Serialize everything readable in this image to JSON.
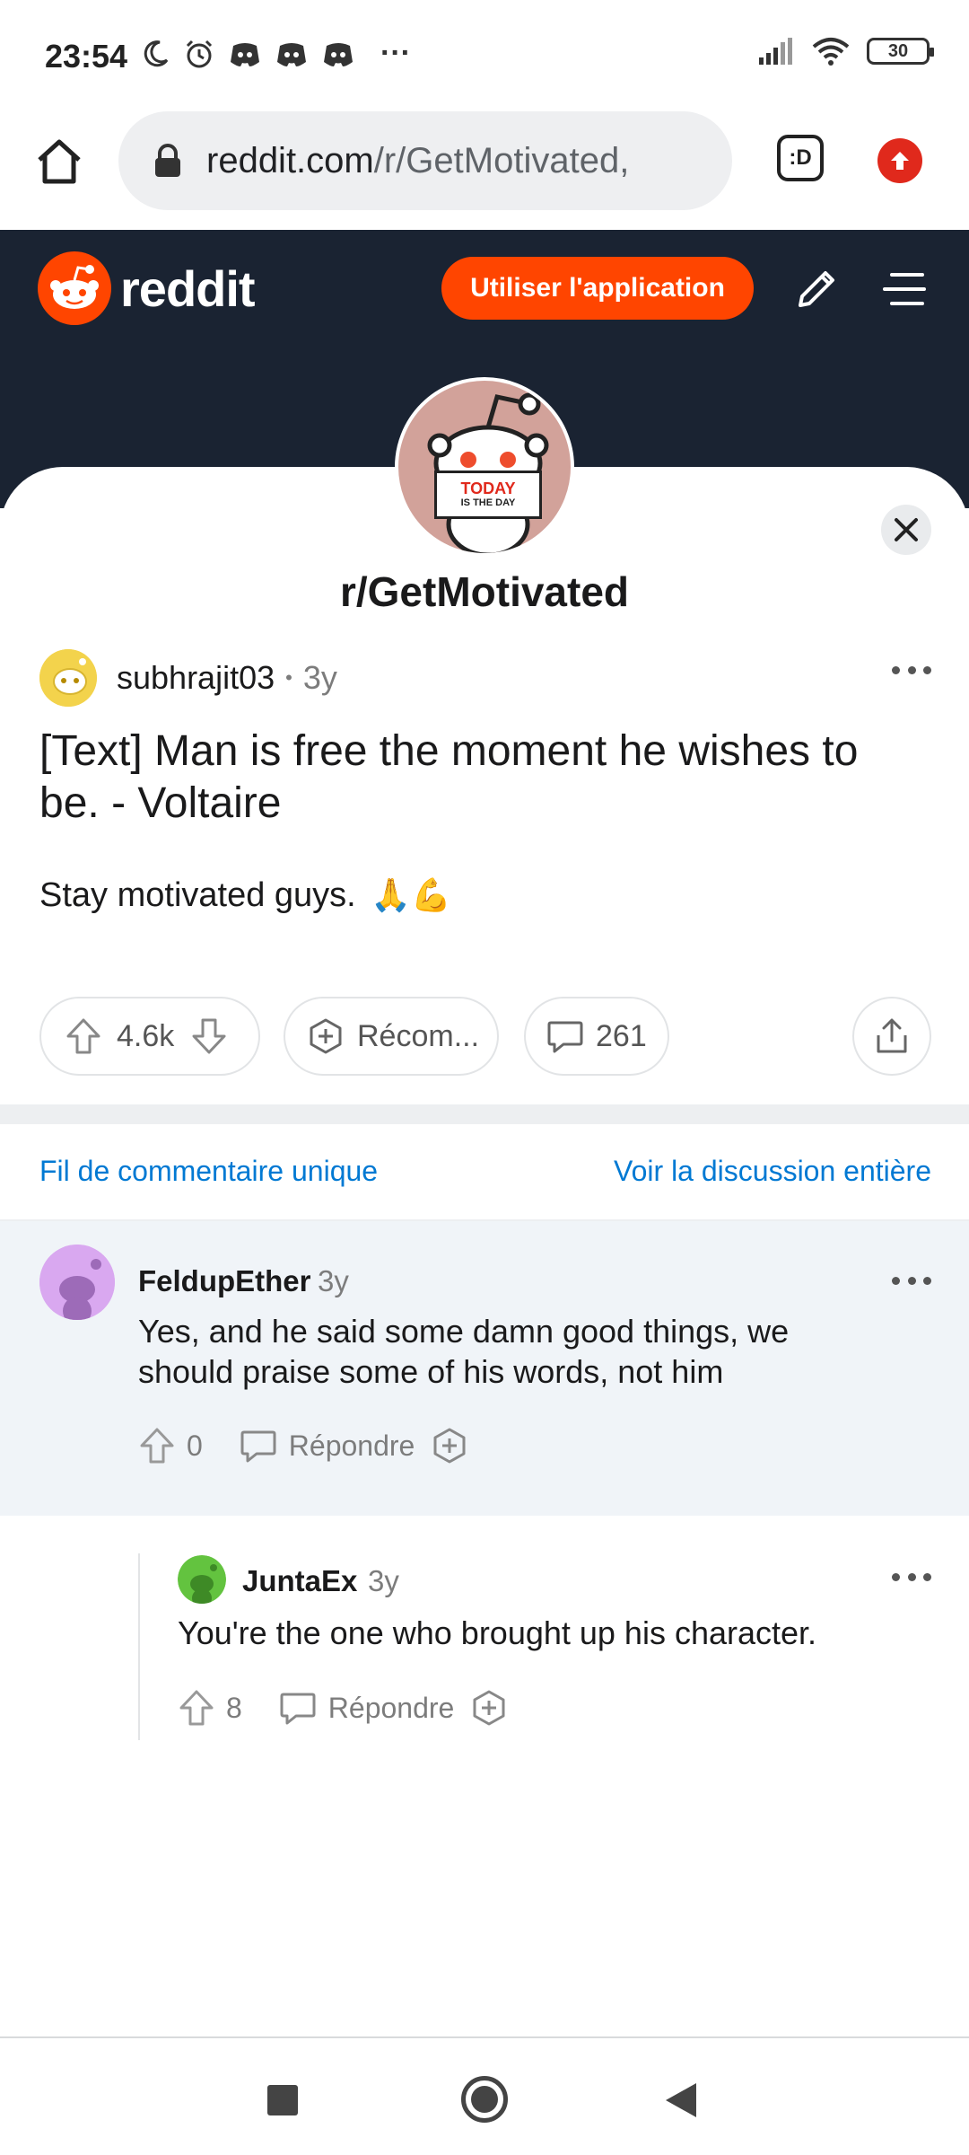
{
  "status_bar": {
    "time": "23:54",
    "battery": "30",
    "more": "···"
  },
  "browser": {
    "url_domain": "reddit.com",
    "url_path": "/r/GetMotivated,",
    "tab_button": ":D"
  },
  "reddit_header": {
    "wordmark": "reddit",
    "app_button": "Utiliser l'application",
    "brand_color": "#ff4500"
  },
  "community": {
    "avatar_line1": "TODAY",
    "avatar_line2": "IS THE DAY",
    "name": "r/GetMotivated"
  },
  "post": {
    "author": "subhrajit03",
    "separator": "•",
    "age": "3y",
    "title": "[Text] Man is free the moment he wishes to be. - Voltaire",
    "body": "Stay motivated guys.",
    "body_emoji": "🙏💪",
    "score": "4.6k",
    "award_label": "Récom...",
    "comments_count": "261"
  },
  "thread_links": {
    "single_thread": "Fil de commentaire unique",
    "full_discussion": "Voir la discussion entière",
    "link_color": "#0079d3"
  },
  "comments": [
    {
      "author": "FeldupEther",
      "age": "3y",
      "text": "Yes, and he said some damn good things, we should praise some of his words, not him",
      "score": "0",
      "reply_label": "Répondre"
    },
    {
      "author": "JuntaEx",
      "age": "3y",
      "text": "You're the one who brought up his character.",
      "score": "8",
      "reply_label": "Répondre"
    }
  ]
}
